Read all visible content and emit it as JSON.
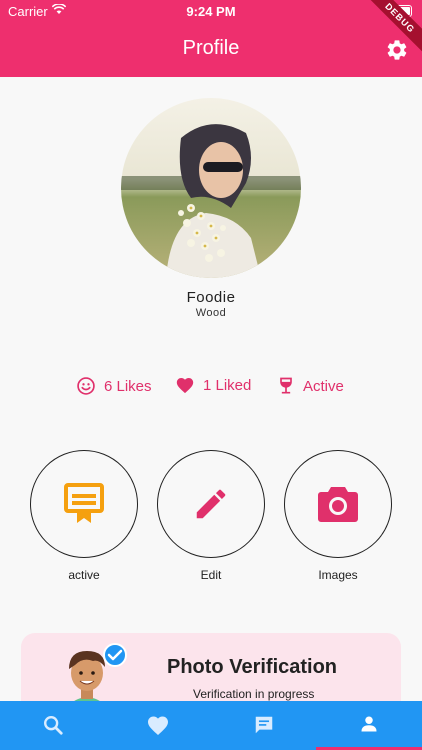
{
  "status": {
    "carrier": "Carrier",
    "time": "9:24 PM"
  },
  "appbar": {
    "title": "Profile",
    "debug": "DEBUG",
    "accent": "#ee2f6e"
  },
  "profile": {
    "name": "Foodie",
    "surname": "Wood"
  },
  "stats": [
    {
      "icon": "smile-icon",
      "label": "6 Likes"
    },
    {
      "icon": "heart-icon",
      "label": "1 Liked"
    },
    {
      "icon": "wine-glass-icon",
      "label": "Active"
    }
  ],
  "actions": [
    {
      "icon": "badge-icon",
      "label": "active",
      "color": "#f5a00f"
    },
    {
      "icon": "pencil-icon",
      "label": "Edit",
      "color": "#e0306b"
    },
    {
      "icon": "camera-icon",
      "label": "Images",
      "color": "#e0306b"
    }
  ],
  "verification": {
    "title": "Photo Verification",
    "subtitle": "Verification in progress"
  },
  "bottom_nav": {
    "items": [
      "search-icon",
      "heart-icon",
      "chat-icon",
      "person-icon"
    ],
    "selected": "person-icon",
    "bg": "#2196f3"
  }
}
